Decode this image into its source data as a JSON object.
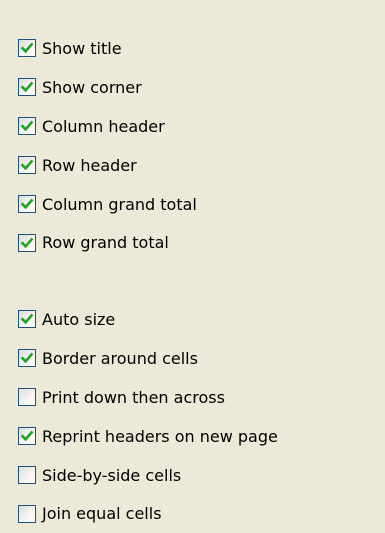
{
  "panel": {
    "groups": [
      {
        "items": [
          {
            "label": "Show title",
            "checked": true
          },
          {
            "label": "Show corner",
            "checked": true
          },
          {
            "label": "Column header",
            "checked": true
          },
          {
            "label": "Row header",
            "checked": true
          },
          {
            "label": "Column grand total",
            "checked": true
          },
          {
            "label": "Row grand total",
            "checked": true
          }
        ]
      },
      {
        "items": [
          {
            "label": "Auto size",
            "checked": true
          },
          {
            "label": "Border around cells",
            "checked": true
          },
          {
            "label": "Print down then across",
            "checked": false
          },
          {
            "label": "Reprint headers on new page",
            "checked": true
          },
          {
            "label": "Side-by-side cells",
            "checked": false
          },
          {
            "label": "Join equal cells",
            "checked": false
          }
        ]
      }
    ]
  },
  "colors": {
    "background": "#ece9d8",
    "checkbox_border": "#1c5180",
    "check_mark": "#21a121"
  }
}
